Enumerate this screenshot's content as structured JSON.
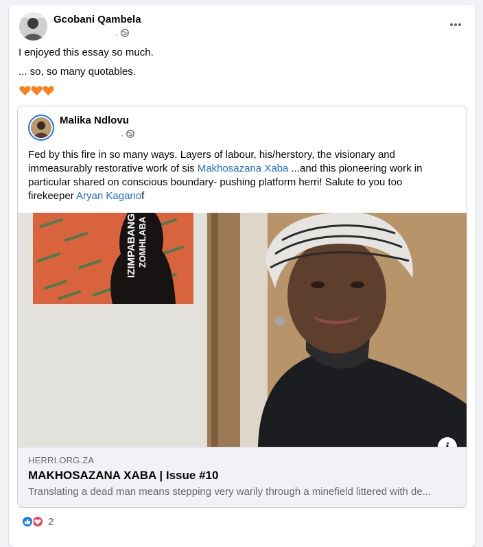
{
  "post": {
    "author": "Gcobani Qambela",
    "meta_sep": "·",
    "line1": "I enjoyed this essay so much.",
    "line2": "... so, so many quotables.",
    "emoji_icons": [
      "orange-heart-icon",
      "orange-heart-icon",
      "orange-heart-icon"
    ]
  },
  "shared": {
    "author": "Malika Ndlovu",
    "meta_sep": "·",
    "body": {
      "l1": "Fed by this fire in so many ways. Layers of labour, his/herstory, the visionary and",
      "l2a": "immeasurably restorative work of sis ",
      "l2_link": "Makhosazana Xaba",
      "l2b": " ...and this pioneering work in",
      "l3": "particular shared on conscious  boundary- pushing platform herri! Salute to you too",
      "l4a": "firekeeper ",
      "l4_link": "Aryan Kagano",
      "l4b": "f"
    },
    "card": {
      "book_title": "IZIMPABANGA",
      "book_subtitle": "ZOMHLABA",
      "domain": "HERRI.ORG.ZA",
      "title": "MAKHOSAZANA XABA | Issue #10",
      "description": "Translating a dead man means stepping very warily through a minefield littered with de...",
      "info_label": "i"
    }
  },
  "reactions": {
    "count": "2",
    "icons": [
      "like-icon",
      "love-icon"
    ]
  },
  "colors": {
    "link": "#216fdb",
    "like": "#1877f2",
    "love": "#f33e58",
    "heart": "#f5821f"
  }
}
